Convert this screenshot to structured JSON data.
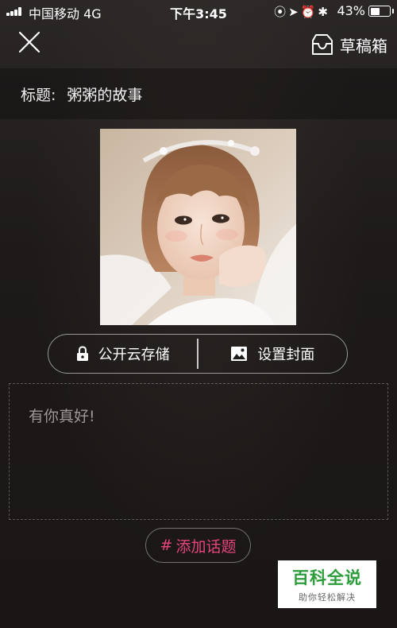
{
  "status_bar": {
    "carrier": "中国移动  4G",
    "time": "下午3:45",
    "battery_percent": "43%",
    "battery_level": 0.43,
    "icons": [
      "orientation-lock-icon",
      "location-arrow-icon",
      "alarm-icon",
      "bluetooth-icon"
    ]
  },
  "header": {
    "close_icon": "close-icon",
    "drafts_label": "草稿箱",
    "drafts_icon": "inbox-tray-icon"
  },
  "title_row": {
    "prefix": "标题:",
    "value": "粥粥的故事"
  },
  "actions": {
    "storage_label": "公开云存储",
    "storage_icon": "lock-icon",
    "cover_label": "设置封面",
    "cover_icon": "image-icon"
  },
  "editor": {
    "text": "有你真好!"
  },
  "topic": {
    "hash": "#",
    "label": "添加话题",
    "color": "#e8457e"
  },
  "watermark": {
    "title": "百科全说",
    "subtitle": "助你轻松解决"
  }
}
